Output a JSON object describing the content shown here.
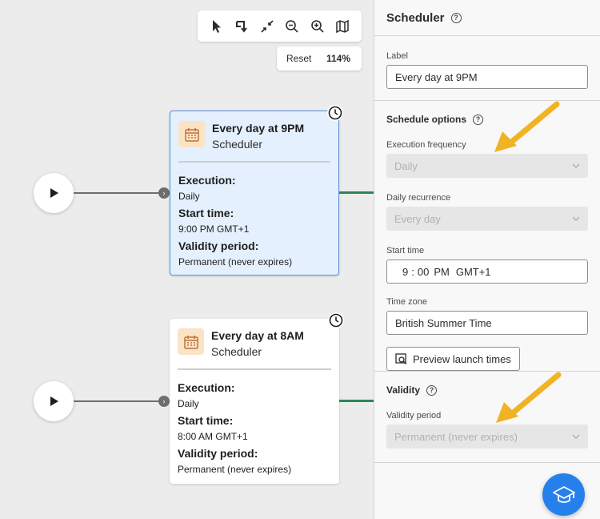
{
  "canvas": {
    "zoom": {
      "reset_label": "Reset",
      "level": "114%"
    },
    "nodes": [
      {
        "title": "Every day at 9PM",
        "type": "Scheduler",
        "execution_label": "Execution:",
        "execution_value": "Daily",
        "start_label": "Start time:",
        "start_value": "9:00 PM GMT+1",
        "validity_label": "Validity period:",
        "validity_value": "Permanent (never expires)"
      },
      {
        "title": "Every day at 8AM",
        "type": "Scheduler",
        "execution_label": "Execution:",
        "execution_value": "Daily",
        "start_label": "Start time:",
        "start_value": "8:00 AM GMT+1",
        "validity_label": "Validity period:",
        "validity_value": "Permanent (never expires)"
      }
    ]
  },
  "panel": {
    "title": "Scheduler",
    "label_field": {
      "label": "Label",
      "value": "Every day at 9PM"
    },
    "schedule_options": {
      "title": "Schedule options",
      "execution_frequency": {
        "label": "Execution frequency",
        "value": "Daily"
      },
      "daily_recurrence": {
        "label": "Daily recurrence",
        "value": "Every day"
      },
      "start_time": {
        "label": "Start time",
        "hour": "9",
        "minute": "00",
        "ampm": "PM",
        "tz": "GMT+1"
      },
      "time_zone": {
        "label": "Time zone",
        "value": "British Summer Time"
      },
      "preview_button": "Preview launch times"
    },
    "validity": {
      "title": "Validity",
      "period": {
        "label": "Validity period",
        "value": "Permanent (never expires)"
      }
    }
  },
  "colors": {
    "accent": "#2680eb",
    "arrow": "#f0b323",
    "flow": "#2d8659",
    "selected_bg": "#e5f0fe"
  },
  "icons": [
    "pointer-icon",
    "rearrange-icon",
    "collapse-icon",
    "zoom-out-icon",
    "zoom-in-icon",
    "map-icon",
    "play-icon",
    "calendar-icon",
    "clock-icon",
    "help-icon",
    "chevron-down-icon",
    "preview-icon",
    "learn-icon"
  ]
}
